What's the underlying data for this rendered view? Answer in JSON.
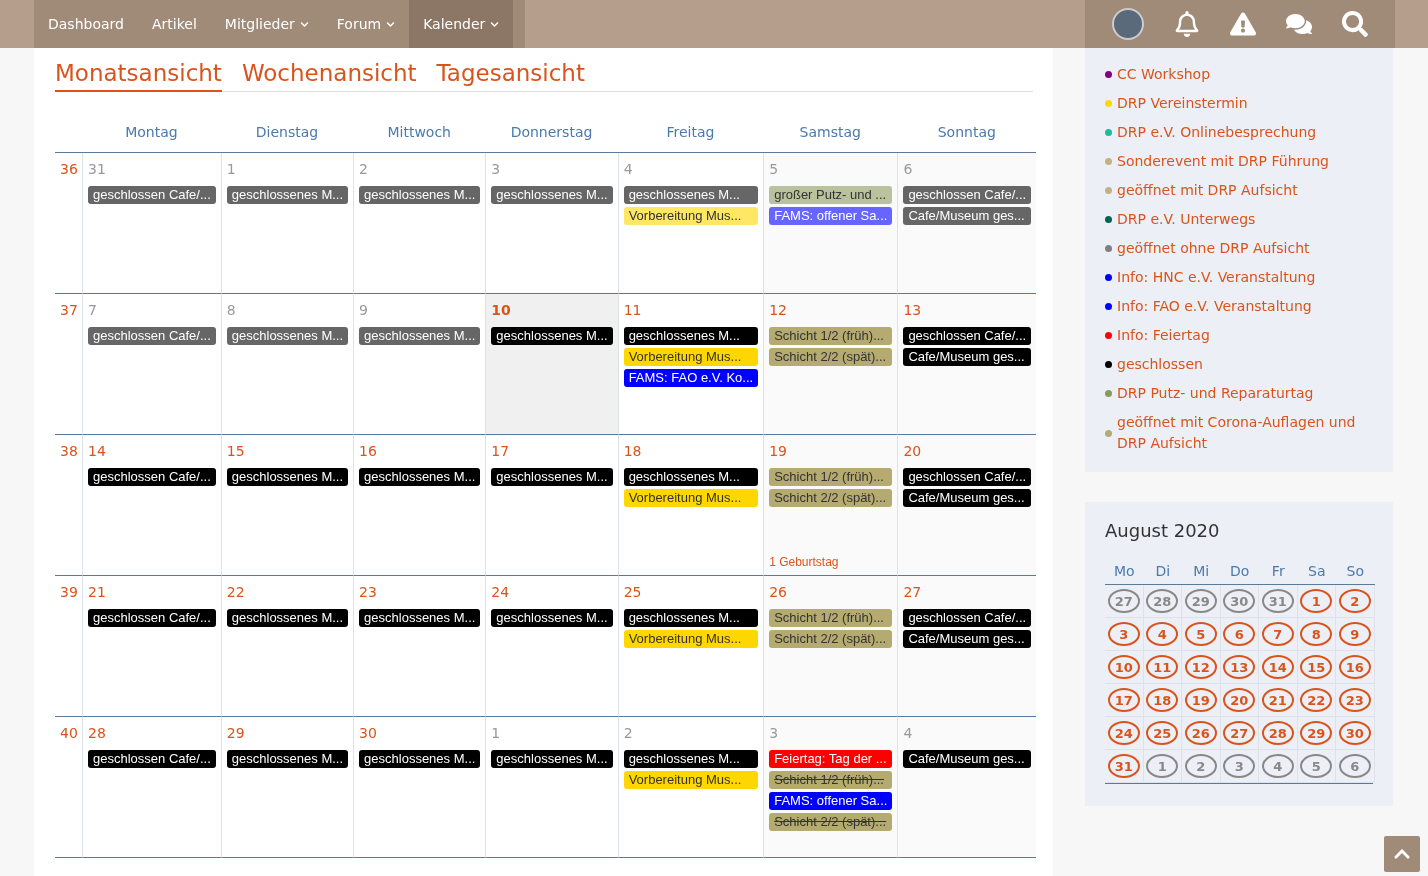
{
  "nav": {
    "items": [
      {
        "label": "Dashboard",
        "has_menu": false,
        "selected": false
      },
      {
        "label": "Artikel",
        "has_menu": false,
        "selected": false
      },
      {
        "label": "Mitglieder",
        "has_menu": true,
        "selected": false
      },
      {
        "label": "Forum",
        "has_menu": true,
        "selected": false
      },
      {
        "label": "Kalender",
        "has_menu": true,
        "selected": true
      }
    ]
  },
  "view_tabs": [
    {
      "label": "Monatsansicht",
      "selected": true
    },
    {
      "label": "Wochenansicht",
      "selected": false
    },
    {
      "label": "Tagesansicht",
      "selected": false
    }
  ],
  "calendar": {
    "weekdays": [
      "Montag",
      "Dienstag",
      "Mittwoch",
      "Donnerstag",
      "Freitag",
      "Samstag",
      "Sonntag"
    ],
    "weeks": [
      {
        "number": "36",
        "days": [
          {
            "day": "31",
            "muted": true,
            "today": false,
            "events": [
              {
                "title": "geschlossen Cafe/...",
                "color": "#666666",
                "cancelled": false
              }
            ]
          },
          {
            "day": "1",
            "muted": true,
            "today": false,
            "events": [
              {
                "title": "geschlossenes M...",
                "color": "#666666",
                "cancelled": false
              }
            ]
          },
          {
            "day": "2",
            "muted": true,
            "today": false,
            "events": [
              {
                "title": "geschlossenes M...",
                "color": "#666666",
                "cancelled": false
              }
            ]
          },
          {
            "day": "3",
            "muted": true,
            "today": false,
            "events": [
              {
                "title": "geschlossenes M...",
                "color": "#666666",
                "cancelled": false
              }
            ]
          },
          {
            "day": "4",
            "muted": true,
            "today": false,
            "events": [
              {
                "title": "geschlossenes M...",
                "color": "#666666",
                "cancelled": false
              },
              {
                "title": "Vorbereitung Mus...",
                "color": "#ffe766",
                "cancelled": false
              }
            ]
          },
          {
            "day": "5",
            "muted": true,
            "today": false,
            "events": [
              {
                "title": "großer Putz- und ...",
                "color": "#b9c29d",
                "cancelled": false
              },
              {
                "title": "FAMS: offener Sa...",
                "color": "#6666ff",
                "cancelled": false
              }
            ]
          },
          {
            "day": "6",
            "muted": true,
            "today": false,
            "events": [
              {
                "title": "geschlossen Cafe/...",
                "color": "#666666",
                "cancelled": false
              },
              {
                "title": "Cafe/Museum ges...",
                "color": "#666666",
                "cancelled": false
              }
            ]
          }
        ]
      },
      {
        "number": "37",
        "days": [
          {
            "day": "7",
            "muted": true,
            "today": false,
            "events": [
              {
                "title": "geschlossen Cafe/...",
                "color": "#666666",
                "cancelled": false
              }
            ]
          },
          {
            "day": "8",
            "muted": true,
            "today": false,
            "events": [
              {
                "title": "geschlossenes M...",
                "color": "#666666",
                "cancelled": false
              }
            ]
          },
          {
            "day": "9",
            "muted": true,
            "today": false,
            "events": [
              {
                "title": "geschlossenes M...",
                "color": "#666666",
                "cancelled": false
              }
            ]
          },
          {
            "day": "10",
            "muted": false,
            "today": true,
            "events": [
              {
                "title": "geschlossenes M...",
                "color": "#000000",
                "cancelled": false
              }
            ]
          },
          {
            "day": "11",
            "muted": false,
            "today": false,
            "events": [
              {
                "title": "geschlossenes M...",
                "color": "#000000",
                "cancelled": false
              },
              {
                "title": "Vorbereitung Mus...",
                "color": "#ffd700",
                "cancelled": false
              },
              {
                "title": "FAMS: FAO e.V. Ko...",
                "color": "#0000ff",
                "cancelled": false
              }
            ]
          },
          {
            "day": "12",
            "muted": false,
            "today": false,
            "events": [
              {
                "title": "Schicht 1/2 (früh)...",
                "color": "#b5aa70",
                "cancelled": false
              },
              {
                "title": "Schicht 2/2 (spät)...",
                "color": "#b5aa70",
                "cancelled": false
              }
            ]
          },
          {
            "day": "13",
            "muted": false,
            "today": false,
            "events": [
              {
                "title": "geschlossen Cafe/...",
                "color": "#000000",
                "cancelled": false
              },
              {
                "title": "Cafe/Museum ges...",
                "color": "#000000",
                "cancelled": false
              }
            ]
          }
        ]
      },
      {
        "number": "38",
        "days": [
          {
            "day": "14",
            "muted": false,
            "today": false,
            "events": [
              {
                "title": "geschlossen Cafe/...",
                "color": "#000000",
                "cancelled": false
              }
            ]
          },
          {
            "day": "15",
            "muted": false,
            "today": false,
            "events": [
              {
                "title": "geschlossenes M...",
                "color": "#000000",
                "cancelled": false
              }
            ]
          },
          {
            "day": "16",
            "muted": false,
            "today": false,
            "events": [
              {
                "title": "geschlossenes M...",
                "color": "#000000",
                "cancelled": false
              }
            ]
          },
          {
            "day": "17",
            "muted": false,
            "today": false,
            "events": [
              {
                "title": "geschlossenes M...",
                "color": "#000000",
                "cancelled": false
              }
            ]
          },
          {
            "day": "18",
            "muted": false,
            "today": false,
            "events": [
              {
                "title": "geschlossenes M...",
                "color": "#000000",
                "cancelled": false
              },
              {
                "title": "Vorbereitung Mus...",
                "color": "#ffd700",
                "cancelled": false
              }
            ]
          },
          {
            "day": "19",
            "muted": false,
            "today": false,
            "birthdays": "1 Geburtstag",
            "events": [
              {
                "title": "Schicht 1/2 (früh)...",
                "color": "#b5aa70",
                "cancelled": false
              },
              {
                "title": "Schicht 2/2 (spät)...",
                "color": "#b5aa70",
                "cancelled": false
              }
            ]
          },
          {
            "day": "20",
            "muted": false,
            "today": false,
            "events": [
              {
                "title": "geschlossen Cafe/...",
                "color": "#000000",
                "cancelled": false
              },
              {
                "title": "Cafe/Museum ges...",
                "color": "#000000",
                "cancelled": false
              }
            ]
          }
        ]
      },
      {
        "number": "39",
        "days": [
          {
            "day": "21",
            "muted": false,
            "today": false,
            "events": [
              {
                "title": "geschlossen Cafe/...",
                "color": "#000000",
                "cancelled": false
              }
            ]
          },
          {
            "day": "22",
            "muted": false,
            "today": false,
            "events": [
              {
                "title": "geschlossenes M...",
                "color": "#000000",
                "cancelled": false
              }
            ]
          },
          {
            "day": "23",
            "muted": false,
            "today": false,
            "events": [
              {
                "title": "geschlossenes M...",
                "color": "#000000",
                "cancelled": false
              }
            ]
          },
          {
            "day": "24",
            "muted": false,
            "today": false,
            "events": [
              {
                "title": "geschlossenes M...",
                "color": "#000000",
                "cancelled": false
              }
            ]
          },
          {
            "day": "25",
            "muted": false,
            "today": false,
            "events": [
              {
                "title": "geschlossenes M...",
                "color": "#000000",
                "cancelled": false
              },
              {
                "title": "Vorbereitung Mus...",
                "color": "#ffd700",
                "cancelled": false
              }
            ]
          },
          {
            "day": "26",
            "muted": false,
            "today": false,
            "events": [
              {
                "title": "Schicht 1/2 (früh)...",
                "color": "#b5aa70",
                "cancelled": false
              },
              {
                "title": "Schicht 2/2 (spät)...",
                "color": "#b5aa70",
                "cancelled": false
              }
            ]
          },
          {
            "day": "27",
            "muted": false,
            "today": false,
            "events": [
              {
                "title": "geschlossen Cafe/...",
                "color": "#000000",
                "cancelled": false
              },
              {
                "title": "Cafe/Museum ges...",
                "color": "#000000",
                "cancelled": false
              }
            ]
          }
        ]
      },
      {
        "number": "40",
        "days": [
          {
            "day": "28",
            "muted": false,
            "today": false,
            "events": [
              {
                "title": "geschlossen Cafe/...",
                "color": "#000000",
                "cancelled": false
              }
            ]
          },
          {
            "day": "29",
            "muted": false,
            "today": false,
            "events": [
              {
                "title": "geschlossenes M...",
                "color": "#000000",
                "cancelled": false
              }
            ]
          },
          {
            "day": "30",
            "muted": false,
            "today": false,
            "events": [
              {
                "title": "geschlossenes M...",
                "color": "#000000",
                "cancelled": false
              }
            ]
          },
          {
            "day": "1",
            "muted": true,
            "today": false,
            "events": [
              {
                "title": "geschlossenes M...",
                "color": "#000000",
                "cancelled": false
              }
            ]
          },
          {
            "day": "2",
            "muted": true,
            "today": false,
            "events": [
              {
                "title": "geschlossenes M...",
                "color": "#000000",
                "cancelled": false
              },
              {
                "title": "Vorbereitung Mus...",
                "color": "#ffd700",
                "cancelled": false
              }
            ]
          },
          {
            "day": "3",
            "muted": true,
            "today": false,
            "events": [
              {
                "title": "Feiertag: Tag der ...",
                "color": "#ff0000",
                "cancelled": false
              },
              {
                "title": "Schicht 1/2 (früh)...",
                "color": "#b5aa70",
                "cancelled": true
              },
              {
                "title": "FAMS: offener Sa...",
                "color": "#0000ff",
                "cancelled": false
              },
              {
                "title": "Schicht 2/2 (spät)...",
                "color": "#b5aa70",
                "cancelled": true
              }
            ]
          },
          {
            "day": "4",
            "muted": true,
            "today": false,
            "events": [
              {
                "title": "Cafe/Museum ges...",
                "color": "#000000",
                "cancelled": false
              }
            ]
          }
        ]
      }
    ]
  },
  "legend": [
    {
      "label": "CC Workshop",
      "color": "#800080"
    },
    {
      "label": "DRP Vereinstermin",
      "color": "#ffd700"
    },
    {
      "label": "DRP e.V. Onlinebesprechung",
      "color": "#1abc9c"
    },
    {
      "label": "Sonderevent mit DRP Führung",
      "color": "#c2b280"
    },
    {
      "label": "geöffnet mit DRP Aufsicht",
      "color": "#bdb28a"
    },
    {
      "label": "DRP e.V. Unterwegs",
      "color": "#006450"
    },
    {
      "label": "geöffnet ohne DRP Aufsicht",
      "color": "#808080"
    },
    {
      "label": "Info: HNC e.V. Veranstaltung",
      "color": "#0000ff"
    },
    {
      "label": "Info: FAO e.V. Veranstaltung",
      "color": "#0000fe"
    },
    {
      "label": "Info: Feiertag",
      "color": "#ff0000"
    },
    {
      "label": "geschlossen",
      "color": "#000000"
    },
    {
      "label": "DRP Putz- und Reparaturtag",
      "color": "#8a9a5b"
    },
    {
      "label": "geöffnet mit Corona-Auflagen und DRP Aufsicht",
      "color": "#b5aa70"
    }
  ],
  "mini_calendar": {
    "title": "August 2020",
    "weekdays": [
      "Mo",
      "Di",
      "Mi",
      "Do",
      "Fr",
      "Sa",
      "So"
    ],
    "weeks": [
      [
        {
          "day": "27",
          "outside": true
        },
        {
          "day": "28",
          "outside": true
        },
        {
          "day": "29",
          "outside": true
        },
        {
          "day": "30",
          "outside": true
        },
        {
          "day": "31",
          "outside": true
        },
        {
          "day": "1",
          "outside": false
        },
        {
          "day": "2",
          "outside": false
        }
      ],
      [
        {
          "day": "3",
          "outside": false
        },
        {
          "day": "4",
          "outside": false
        },
        {
          "day": "5",
          "outside": false
        },
        {
          "day": "6",
          "outside": false
        },
        {
          "day": "7",
          "outside": false
        },
        {
          "day": "8",
          "outside": false
        },
        {
          "day": "9",
          "outside": false
        }
      ],
      [
        {
          "day": "10",
          "outside": false
        },
        {
          "day": "11",
          "outside": false
        },
        {
          "day": "12",
          "outside": false
        },
        {
          "day": "13",
          "outside": false
        },
        {
          "day": "14",
          "outside": false
        },
        {
          "day": "15",
          "outside": false
        },
        {
          "day": "16",
          "outside": false
        }
      ],
      [
        {
          "day": "17",
          "outside": false
        },
        {
          "day": "18",
          "outside": false
        },
        {
          "day": "19",
          "outside": false
        },
        {
          "day": "20",
          "outside": false
        },
        {
          "day": "21",
          "outside": false
        },
        {
          "day": "22",
          "outside": false
        },
        {
          "day": "23",
          "outside": false
        }
      ],
      [
        {
          "day": "24",
          "outside": false
        },
        {
          "day": "25",
          "outside": false
        },
        {
          "day": "26",
          "outside": false
        },
        {
          "day": "27",
          "outside": false
        },
        {
          "day": "28",
          "outside": false
        },
        {
          "day": "29",
          "outside": false
        },
        {
          "day": "30",
          "outside": false
        }
      ],
      [
        {
          "day": "31",
          "outside": false
        },
        {
          "day": "1",
          "outside": true
        },
        {
          "day": "2",
          "outside": true
        },
        {
          "day": "3",
          "outside": true
        },
        {
          "day": "4",
          "outside": true
        },
        {
          "day": "5",
          "outside": true
        },
        {
          "day": "6",
          "outside": true
        }
      ]
    ]
  }
}
